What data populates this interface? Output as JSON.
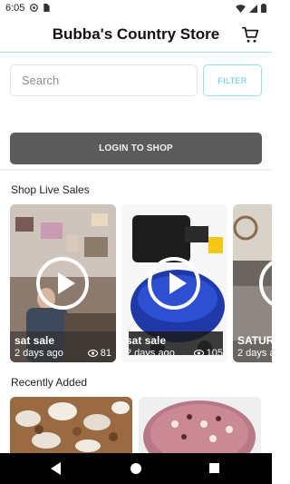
{
  "status_bar": {
    "time": "6:05"
  },
  "header": {
    "title": "Bubba's Country Store",
    "cart_icon": "cart-icon"
  },
  "search": {
    "placeholder": "Search",
    "value": "",
    "filter_label": "FILTER"
  },
  "login": {
    "label": "LOGIN TO SHOP"
  },
  "live_sales": {
    "title": "Shop Live Sales",
    "items": [
      {
        "name": "sat sale",
        "ago": "2 days ago",
        "views": "81"
      },
      {
        "name": "sat sale",
        "ago": "2 days ago",
        "views": "105"
      },
      {
        "name": "SATURI",
        "ago": "2 days a"
      }
    ]
  },
  "recently_added": {
    "title": "Recently Added"
  },
  "colors": {
    "accent": "#56cfe0",
    "login_bg": "#5b5b5b",
    "header_border": "#9fe3e6"
  }
}
